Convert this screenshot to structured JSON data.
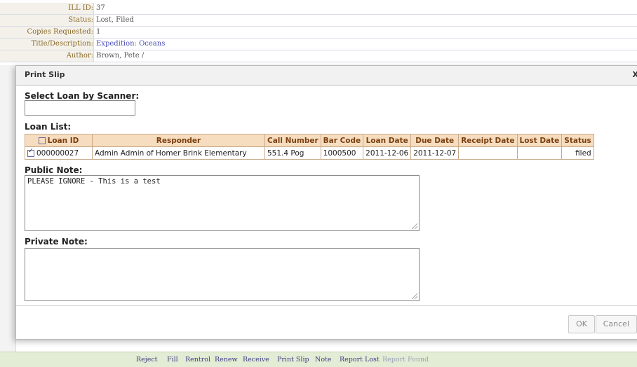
{
  "background_fields": [
    {
      "label": "ILL ID:",
      "value": "37",
      "link": false
    },
    {
      "label": "Status:",
      "value": "Lost, Filed",
      "link": false
    },
    {
      "label": "Copies Requested:",
      "value": "1",
      "link": false
    },
    {
      "label": "Title/Description:",
      "value": "Expedition: Oceans",
      "link": true
    },
    {
      "label": "Author:",
      "value": "Brown, Pete /",
      "link": false
    }
  ],
  "dialog": {
    "title": "Print Slip",
    "close": "X",
    "scanner_label": "Select Loan by Scanner:",
    "scanner_value": "",
    "loan_list_label": "Loan List:",
    "loan_table": {
      "headers": [
        "Loan ID",
        "Responder",
        "Call Number",
        "Bar Code",
        "Loan Date",
        "Due Date",
        "Receipt Date",
        "Lost Date",
        "Status"
      ],
      "rows": [
        {
          "checked": true,
          "loan_id": "000000027",
          "responder": "Admin Admin of Homer Brink Elementary",
          "call_number": "551.4 Pog",
          "bar_code": "1000500",
          "loan_date": "2011-12-06",
          "due_date": "2011-12-07",
          "receipt_date": "",
          "lost_date": "",
          "status": "filed"
        }
      ]
    },
    "public_note_label": "Public Note:",
    "public_note_value": "PLEASE IGNORE - This is a test",
    "private_note_label": "Private Note:",
    "private_note_value": "",
    "ok_label": "OK",
    "cancel_label": "Cancel"
  },
  "actions": [
    {
      "label": "Reject",
      "disabled": false
    },
    {
      "label": "Fill",
      "disabled": false
    },
    {
      "label": "Rentrol",
      "disabled": false
    },
    {
      "label": "Renew",
      "disabled": false
    },
    {
      "label": "Receive",
      "disabled": false
    },
    {
      "label": "Print Slip",
      "disabled": false
    },
    {
      "label": "Note",
      "disabled": false
    },
    {
      "label": "Report Lost",
      "disabled": false
    },
    {
      "label": "Report Found",
      "disabled": true
    }
  ]
}
